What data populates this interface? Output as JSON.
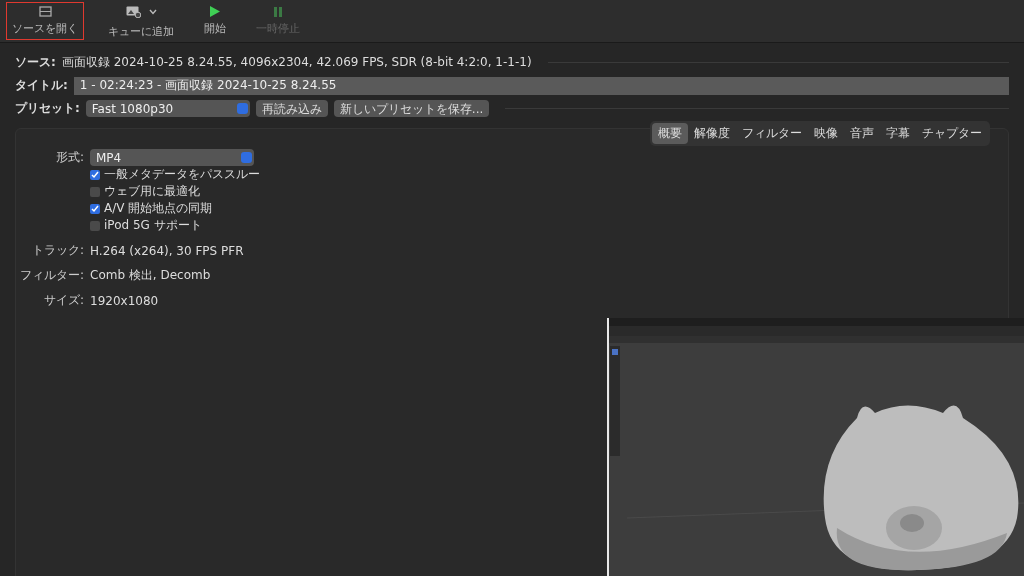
{
  "toolbar": [
    {
      "kind": "open",
      "label": "ソースを開く",
      "highlighted": true,
      "disabled": false
    },
    {
      "kind": "queue",
      "label": "キューに追加",
      "highlighted": false,
      "disabled": false
    },
    {
      "kind": "start",
      "label": "開始",
      "highlighted": false,
      "disabled": false
    },
    {
      "kind": "pause",
      "label": "一時停止",
      "highlighted": false,
      "disabled": true
    }
  ],
  "source": {
    "label": "ソース:",
    "value": "画面収録 2024-10-25 8.24.55, 4096x2304, 42.069 FPS, SDR (8-bit 4:2:0, 1-1-1)"
  },
  "title": {
    "label": "タイトル:",
    "value": "1 - 02:24:23 - 画面収録 2024-10-25 8.24.55"
  },
  "preset": {
    "label": "プリセット:",
    "value": "Fast 1080p30",
    "buttons": [
      "再読み込み",
      "新しいプリセットを保存..."
    ]
  },
  "tabs": [
    {
      "label": "概要",
      "selected": true
    },
    {
      "label": "解像度",
      "selected": false
    },
    {
      "label": "フィルター",
      "selected": false
    },
    {
      "label": "映像",
      "selected": false
    },
    {
      "label": "音声",
      "selected": false
    },
    {
      "label": "字幕",
      "selected": false
    },
    {
      "label": "チャプター",
      "selected": false
    }
  ],
  "format": {
    "label": "形式:",
    "value": "MP4"
  },
  "options": [
    {
      "label": "一般メタデータをパススルー",
      "checked": true
    },
    {
      "label": "ウェブ用に最適化",
      "checked": false
    },
    {
      "label": "A/V 開始地点の同期",
      "checked": true
    },
    {
      "label": "iPod 5G サポート",
      "checked": false
    }
  ],
  "summary": [
    {
      "label": "トラック:",
      "value": "H.264 (x264), 30 FPS PFR"
    },
    {
      "label": "フィルター:",
      "value": "Comb 検出, Decomb"
    },
    {
      "label": "サイズ:",
      "value": "1920x1080"
    }
  ]
}
